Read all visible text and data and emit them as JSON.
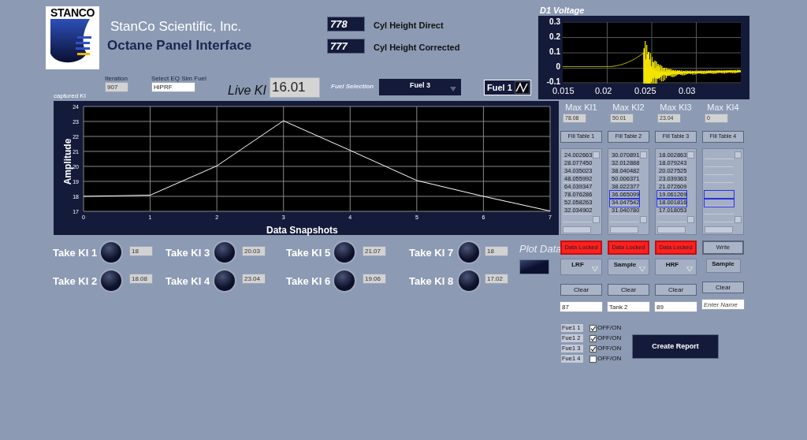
{
  "header": {
    "logo_text": "STANCO",
    "company": "StanCo Scientific, Inc.",
    "title": "Octane Panel Interface"
  },
  "indicators": [
    {
      "value": "778",
      "label": "Cyl Height Direct"
    },
    {
      "value": "777",
      "label": "Cyl Height Corrected"
    }
  ],
  "d1_voltage": {
    "title": "D1 Voltage",
    "yticks": [
      "0.3",
      "0.2",
      "0.1",
      "0",
      "-0.1"
    ],
    "xticks": [
      "0.015",
      "0.02",
      "0.025",
      "0.03"
    ]
  },
  "iteration": {
    "label": "Iteration",
    "value": "907"
  },
  "eq_sim_fuel": {
    "label": "Select EQ Sim Fuel",
    "value": "HiPRF"
  },
  "live_ki": {
    "label": "Live KI",
    "value": "16.01"
  },
  "fuel_selection": {
    "label": "Fuel Selection",
    "value": "Fuel 3"
  },
  "fuel_toggle": {
    "label": "Fuel 1"
  },
  "captured_ki": {
    "chart_data": {
      "type": "line",
      "grid": true,
      "xlabel": "Data Snapshots",
      "ylabel": "Amplitude",
      "x": [
        0,
        1,
        2,
        3,
        4,
        5,
        6,
        7
      ],
      "series": [
        {
          "name": "captured KI",
          "color": "#ffffff",
          "values": [
            18,
            18.08,
            20.03,
            23.04,
            21.07,
            19.06,
            18,
            17.02
          ]
        }
      ],
      "xlim": [
        0,
        7
      ],
      "ylim": [
        17,
        24
      ],
      "xticks": [
        0,
        1,
        2,
        3,
        4,
        5,
        6,
        7
      ],
      "yticks": [
        17,
        18,
        19,
        20,
        21,
        22,
        23,
        24
      ]
    }
  },
  "take_ki": [
    {
      "label": "Take KI 1",
      "value": "18"
    },
    {
      "label": "Take KI 2",
      "value": "18.08"
    },
    {
      "label": "Take KI 3",
      "value": "20.03"
    },
    {
      "label": "Take KI 4",
      "value": "23.04"
    },
    {
      "label": "Take KI 5",
      "value": "21.07"
    },
    {
      "label": "Take KI 6",
      "value": "19.06"
    },
    {
      "label": "Take KI 7",
      "value": "18"
    },
    {
      "label": "Take KI 8",
      "value": "17.02"
    }
  ],
  "plot_data": {
    "label": "Plot Data"
  },
  "channels": [
    {
      "max_label": "Max KI1",
      "max_value": "78.08",
      "fill_button": "Fill Table 1",
      "rows": [
        "24.002663",
        "28.077450",
        "34.035023",
        "48.055992",
        "64.039347",
        "78.076286",
        "52.058263",
        "32.034902"
      ],
      "selection_outline": false,
      "action": {
        "kind": "locked",
        "label": "Data Locked"
      },
      "fuel_type": {
        "kind": "dropdown",
        "value": "LRF"
      },
      "clear_button": "Clear",
      "name_field": {
        "value": "87"
      }
    },
    {
      "max_label": "Max KI2",
      "max_value": "50.01",
      "fill_button": "Fill Table 2",
      "rows": [
        "30.070891",
        "32.012888",
        "38.040482",
        "50.006371",
        "38.022377",
        "36.065099",
        "34.047542",
        "31.040780"
      ],
      "selection_outline": true,
      "action": {
        "kind": "locked",
        "label": "Data Locked"
      },
      "fuel_type": {
        "kind": "dropdown",
        "value": "Sample"
      },
      "clear_button": "Clear",
      "name_field": {
        "value": "Tank 2"
      }
    },
    {
      "max_label": "Max KI3",
      "max_value": "23.04",
      "fill_button": "Fill Table 3",
      "rows": [
        "18.002863",
        "18.079243",
        "20.027525",
        "23.039363",
        "21.072609",
        "19.061269",
        "18.001816",
        "17.018053"
      ],
      "selection_outline": true,
      "action": {
        "kind": "locked",
        "label": "Data Locked"
      },
      "fuel_type": {
        "kind": "dropdown",
        "value": "HRF"
      },
      "clear_button": "Clear",
      "name_field": {
        "value": "89"
      }
    },
    {
      "max_label": "Max KI4",
      "max_value": "0",
      "fill_button": "Fill Table 4",
      "selection_outline": true,
      "action": {
        "kind": "button",
        "label": "Write"
      },
      "fuel_type": {
        "kind": "indicator",
        "value": "Sample"
      },
      "clear_button": "Clear",
      "name_field": {
        "placeholder": "Enter Name"
      }
    }
  ],
  "fuel_enables": [
    {
      "label": "Fue1 1",
      "checked": true,
      "text": "OFF/ON"
    },
    {
      "label": "Fue1 2",
      "checked": true,
      "text": "OFF/ON"
    },
    {
      "label": "Fue1 3",
      "checked": true,
      "text": "OFF/ON"
    },
    {
      "label": "Fue1 4",
      "checked": false,
      "text": "OFF/ON"
    }
  ],
  "create_report": {
    "label": "Create Report"
  }
}
